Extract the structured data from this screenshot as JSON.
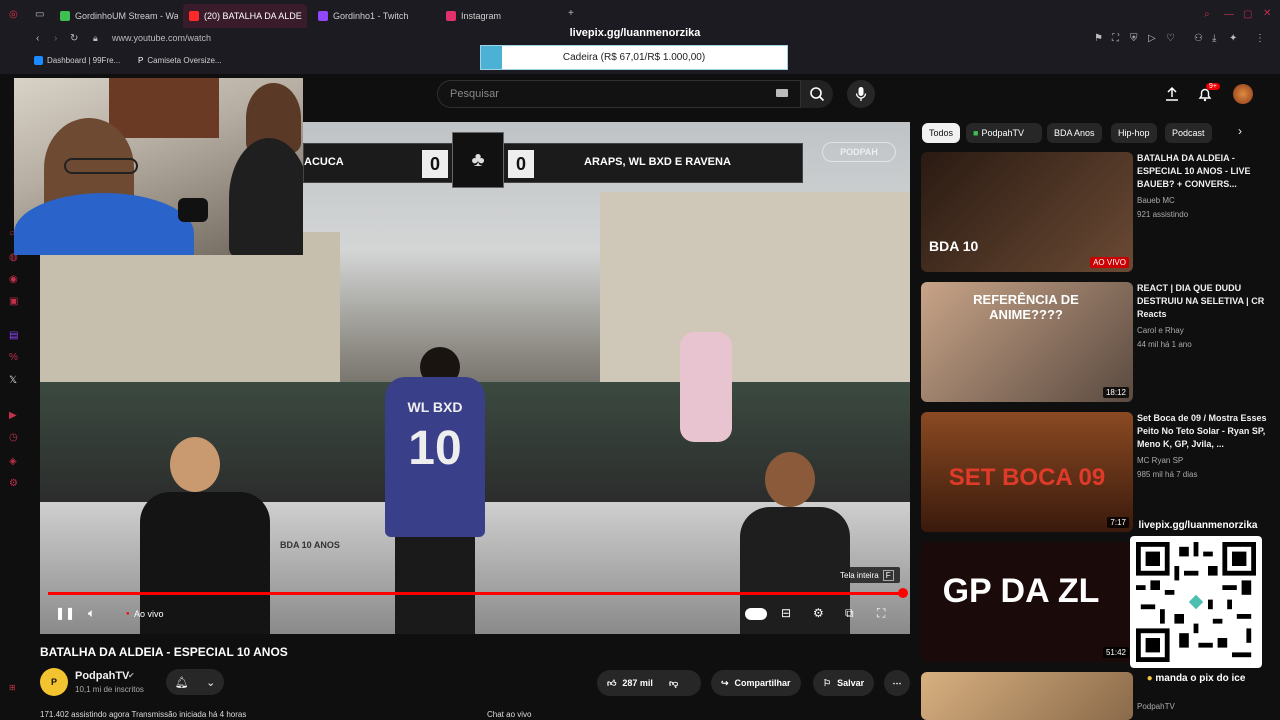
{
  "browser": {
    "tabs": [
      {
        "label": "GordinhoUM Stream - Wat",
        "color": "#3fbf4f"
      },
      {
        "label": "(20) BATALHA DA ALDE",
        "color": "#ff2a2a"
      },
      {
        "label": "Gordinho1 - Twitch",
        "color": "#9146ff"
      },
      {
        "label": "Instagram",
        "color": "#e1306c"
      }
    ],
    "new_tab": "+",
    "url": "www.youtube.com/watch",
    "bookmarks": [
      {
        "label": "Dashboard | 99Fre..."
      },
      {
        "label": "Camiseta Oversize..."
      }
    ]
  },
  "overlay": {
    "pix_url": "livepix.gg/luanmenorzika",
    "goal_text": "Cadeira (R$ 67,01/R$ 1.000,00)",
    "goal_fraction": 0.067,
    "qr_label": "livepix.gg/luanmenorzika",
    "qr_cta": "manda o pix do ice"
  },
  "header": {
    "search_placeholder": "Pesquisar",
    "notif_count": "9+"
  },
  "video": {
    "score_left_name": "ACUCA",
    "score_left": "0",
    "score_right": "0",
    "score_right_name": "ARAPS, WL BXD E RAVENA",
    "watermark": "PODPAH",
    "jersey_text": "WL BXD",
    "jersey_number": "10",
    "banner_text": "BDA 10 ANOS",
    "live_label": "Ao vivo",
    "fullscreen_tip": "Tela inteira",
    "fullscreen_key": "F",
    "progress": 1.0
  },
  "info": {
    "title": "BATALHA DA ALDEIA - ESPECIAL 10 ANOS",
    "channel": "PodpahTV",
    "subs": "10,1 mi de inscritos",
    "likes": "287 mil",
    "share": "Compartilhar",
    "save": "Salvar",
    "desc_line": "171.402 assistindo agora  Transmissão iniciada há 4 horas",
    "chat_label": "Chat ao vivo"
  },
  "chips": [
    {
      "label": "Todos"
    },
    {
      "label": "PodpahTV"
    },
    {
      "label": "BDA Anos"
    },
    {
      "label": "Hip-hop"
    },
    {
      "label": "Podcast"
    }
  ],
  "recommendations": [
    {
      "title": "BATALHA DA ALDEIA - ESPECIAL 10 ANOS - LIVE BAUEB? + CONVERS...",
      "channel": "Baueb MC",
      "meta": "921 assistindo",
      "badge": "AO VIVO",
      "thumb_text": "BDA 10",
      "thumb_color": "#3a2418"
    },
    {
      "title": "REACT | DIA QUE DUDU DESTRUIU NA SELETIVA | CR Reacts",
      "channel": "Carol e Rhay",
      "meta": "44 mil  há 1 ano",
      "badge": "18:12",
      "thumb_text": "REFERÊNCIA DE ANIME????",
      "thumb_color": "#5a4a40"
    },
    {
      "title": "Set Boca de 09 / Mostra Esses Peito No Teto Solar - Ryan SP, Meno K, GP, Jvila, ...",
      "channel": "MC Ryan SP",
      "meta": "985 mil  há 7 dias",
      "badge": "7:17",
      "thumb_text": "SET BOCA 09",
      "thumb_color": "#5c2a14"
    },
    {
      "title": "",
      "channel": "",
      "meta": "",
      "badge": "51:42",
      "thumb_text": "GP DA ZL",
      "thumb_color": "#1a0a0a"
    },
    {
      "title": "",
      "channel": "PodpahTV",
      "meta": "",
      "badge": "",
      "thumb_text": "",
      "thumb_color": "#c8a070"
    }
  ]
}
